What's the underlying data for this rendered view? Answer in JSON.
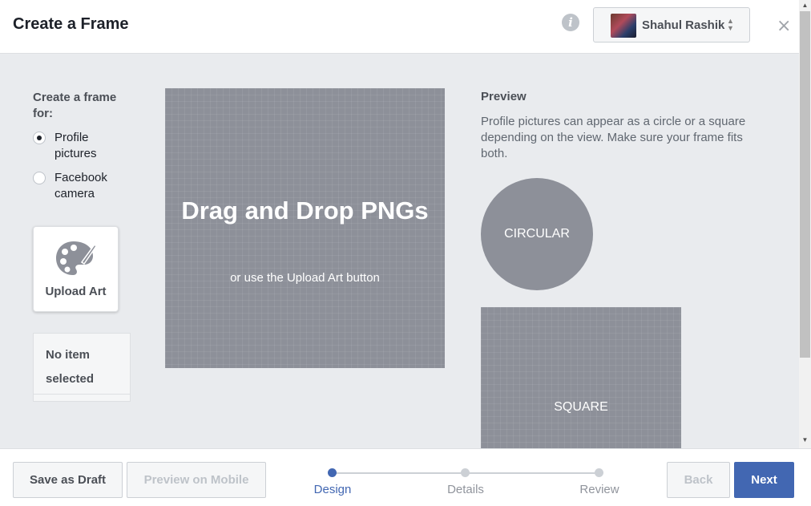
{
  "header": {
    "title": "Create a Frame",
    "account_name": "Shahul Rashik",
    "info_icon": "info-icon",
    "close_glyph": "×"
  },
  "sidebar": {
    "frame_for_label": "Create a frame for:",
    "options": [
      {
        "label": "Profile pictures",
        "checked": true
      },
      {
        "label": "Facebook camera",
        "checked": false
      }
    ],
    "upload_art_label": "Upload Art",
    "no_item_text": "No item selected"
  },
  "dropzone": {
    "title": "Drag and Drop PNGs",
    "subtitle": "or use the Upload Art button"
  },
  "preview": {
    "title": "Preview",
    "description": "Profile pictures can appear as a circle or a square depending on the view. Make sure your frame fits both.",
    "circle_label": "CIRCULAR",
    "square_label": "SQUARE"
  },
  "footer": {
    "save_draft": "Save as Draft",
    "preview_mobile": "Preview on Mobile",
    "steps": [
      {
        "label": "Design",
        "active": true
      },
      {
        "label": "Details",
        "active": false
      },
      {
        "label": "Review",
        "active": false
      }
    ],
    "back": "Back",
    "next": "Next"
  },
  "colors": {
    "accent": "#4267b2",
    "placeholder_gray": "#8d9099",
    "panel_bg": "#e9ebee"
  }
}
